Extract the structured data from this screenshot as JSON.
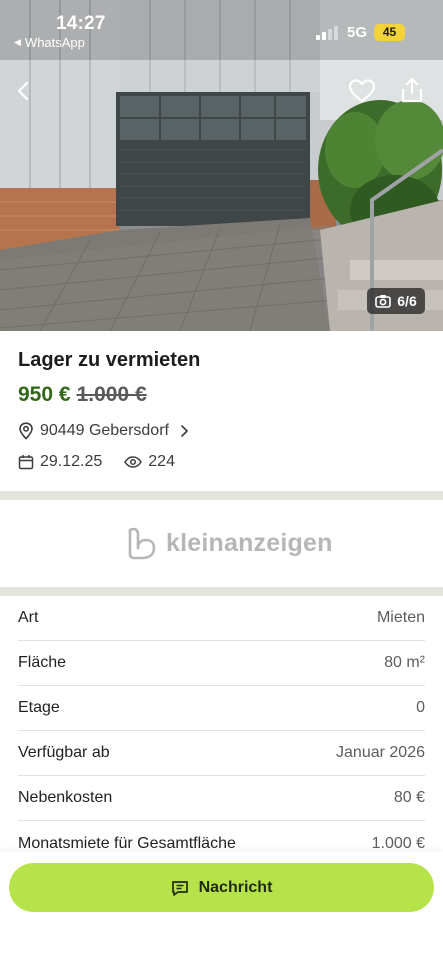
{
  "status": {
    "time": "14:27",
    "back_app": "WhatsApp",
    "network": "5G",
    "battery": "45"
  },
  "gallery": {
    "counter": "6/6"
  },
  "listing": {
    "title": "Lager zu vermieten",
    "price": "950 €",
    "old_price": "1.000 €",
    "location": "90449 Gebersdorf",
    "date": "29.12.25",
    "views": "224"
  },
  "brand": {
    "name": "kleinanzeigen"
  },
  "attributes": [
    {
      "key": "Art",
      "value": "Mieten"
    },
    {
      "key": "Fläche",
      "value": "80 m²"
    },
    {
      "key": "Etage",
      "value": "0"
    },
    {
      "key": "Verfügbar ab",
      "value": "Januar 2026"
    },
    {
      "key": "Nebenkosten",
      "value": "80 €"
    },
    {
      "key": "Monatsmiete für Gesamtfläche",
      "value": "1.000 €"
    }
  ],
  "actions": {
    "message_label": "Nachricht"
  },
  "colors": {
    "price": "#326916",
    "cta": "#b7e34a",
    "battery": "#f3d23a"
  },
  "icons": [
    "chevron-left-icon",
    "heart-icon",
    "share-icon",
    "camera-icon",
    "location-pin-icon",
    "chevron-right-icon",
    "calendar-icon",
    "eye-icon",
    "kleinanzeigen-logo-icon",
    "message-icon"
  ]
}
